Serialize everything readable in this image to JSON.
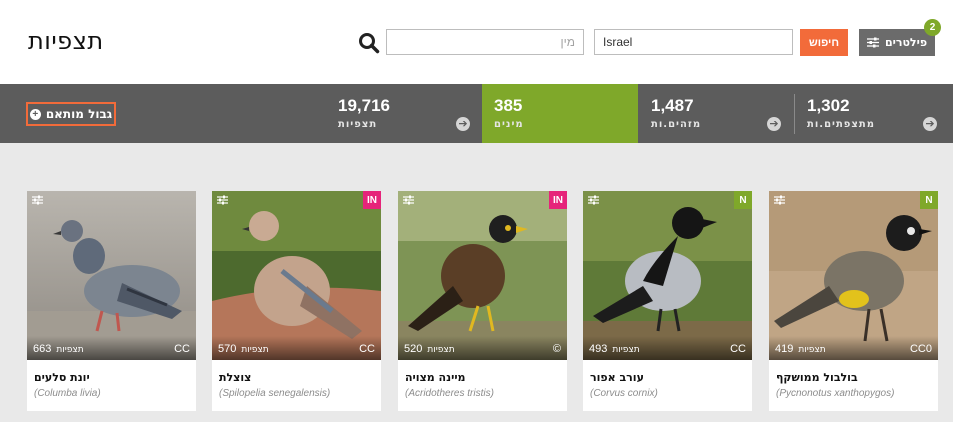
{
  "header": {
    "title": "תצפיות",
    "species_placeholder": "מין",
    "place_value": "Israel",
    "search_label": "חיפוש",
    "filters_label": "פילטרים",
    "filters_count": "2"
  },
  "stats": {
    "custom_border_label": "גבול מותאם",
    "items": [
      {
        "value": "19,716",
        "label": "תצפיות"
      },
      {
        "value": "385",
        "label": "מינים"
      },
      {
        "value": "1,487",
        "label": "מזהים.ות"
      },
      {
        "value": "1,302",
        "label": "מתצפתים.ות"
      }
    ]
  },
  "cards": [
    {
      "name": "יונת סלעים",
      "scientific": "(Columba livia)",
      "count": "663",
      "count_label": "תצפיות",
      "license": "CC",
      "badge": "",
      "badge_color": ""
    },
    {
      "name": "צוצלת",
      "scientific": "(Spilopelia senegalensis)",
      "count": "570",
      "count_label": "תצפיות",
      "license": "CC",
      "badge": "IN",
      "badge_color": "#e6247a"
    },
    {
      "name": "מיינה מצויה",
      "scientific": "(Acridotheres tristis)",
      "count": "520",
      "count_label": "תצפיות",
      "license": "©",
      "badge": "IN",
      "badge_color": "#e6247a"
    },
    {
      "name": "עורב אפור",
      "scientific": "(Corvus cornix)",
      "count": "493",
      "count_label": "תצפיות",
      "license": "CC",
      "badge": "N",
      "badge_color": "#7fa82a"
    },
    {
      "name": "בולבול ממושקף",
      "scientific": "(Pycnonotus xanthopygos)",
      "count": "419",
      "count_label": "תצפיות",
      "license": "CC0",
      "badge": "N",
      "badge_color": "#7fa82a"
    }
  ],
  "icons": {
    "search": "search-icon",
    "filters": "sliders-icon",
    "card_settings": "sliders-icon",
    "stat_arrow": "arrow-right-icon",
    "custom_border": "plus-circle-icon"
  }
}
